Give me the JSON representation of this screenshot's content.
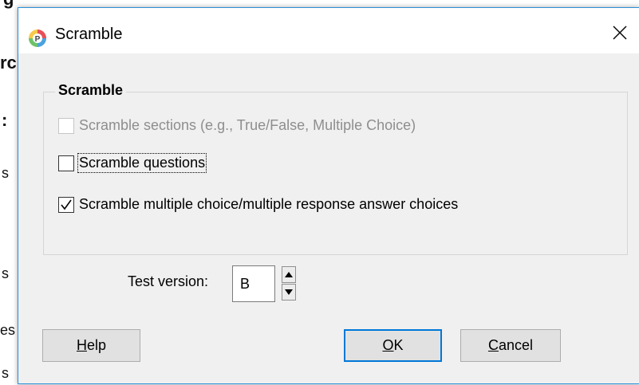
{
  "background": {
    "fragments": [
      "g",
      "rc",
      ":",
      "s",
      "s",
      "es",
      "s"
    ]
  },
  "dialog": {
    "title": "Scramble",
    "icons": {
      "app": "app-logo-icon",
      "close": "close-icon"
    }
  },
  "group": {
    "title": "Scramble",
    "options": [
      {
        "label": "Scramble sections (e.g., True/False, Multiple Choice)",
        "checked": false,
        "enabled": false
      },
      {
        "label": "Scramble questions",
        "checked": false,
        "enabled": true,
        "focused": true
      },
      {
        "label": "Scramble multiple choice/multiple response answer choices",
        "checked": true,
        "enabled": true
      }
    ]
  },
  "version": {
    "label": "Test version:",
    "value": "B",
    "icons": {
      "up": "spin-up-icon",
      "down": "spin-down-icon"
    }
  },
  "buttons": {
    "help": {
      "mnemonic": "H",
      "rest": "elp"
    },
    "ok": {
      "mnemonic": "O",
      "rest": "K"
    },
    "cancel": {
      "mnemonic": "C",
      "rest": "ancel"
    }
  },
  "colors": {
    "window_border": "#2b8fd8",
    "default_button_border": "#0078d7",
    "dialog_background": "#f0f0f0"
  }
}
